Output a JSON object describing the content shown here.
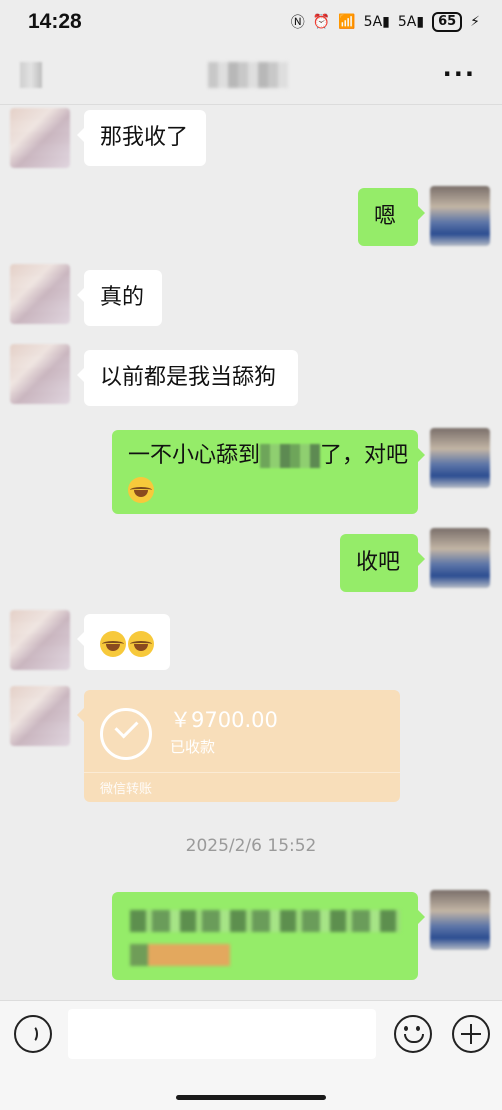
{
  "status_bar": {
    "time": "14:28",
    "signal1": "5A",
    "signal2": "5A",
    "battery": "65"
  },
  "nav": {
    "more_label": "···"
  },
  "messages": [
    {
      "side": "left",
      "text": "那我收了"
    },
    {
      "side": "right",
      "text": "嗯"
    },
    {
      "side": "left",
      "text": "真的"
    },
    {
      "side": "left",
      "text": "以前都是我当舔狗"
    },
    {
      "side": "right",
      "text_line1_a": "一不小心舔到",
      "text_line1_b": "了，对吧"
    },
    {
      "side": "right",
      "text": "收吧"
    },
    {
      "side": "left",
      "text": ""
    }
  ],
  "transfer": {
    "amount": "￥9700.00",
    "status": "已收款",
    "footer": "微信转账"
  },
  "timestamp": "2025/2/6 15:52",
  "colors": {
    "background": "#ededed",
    "bubble_green": "#95ec69",
    "bubble_white": "#ffffff",
    "transfer_bg": "#f8deba"
  }
}
